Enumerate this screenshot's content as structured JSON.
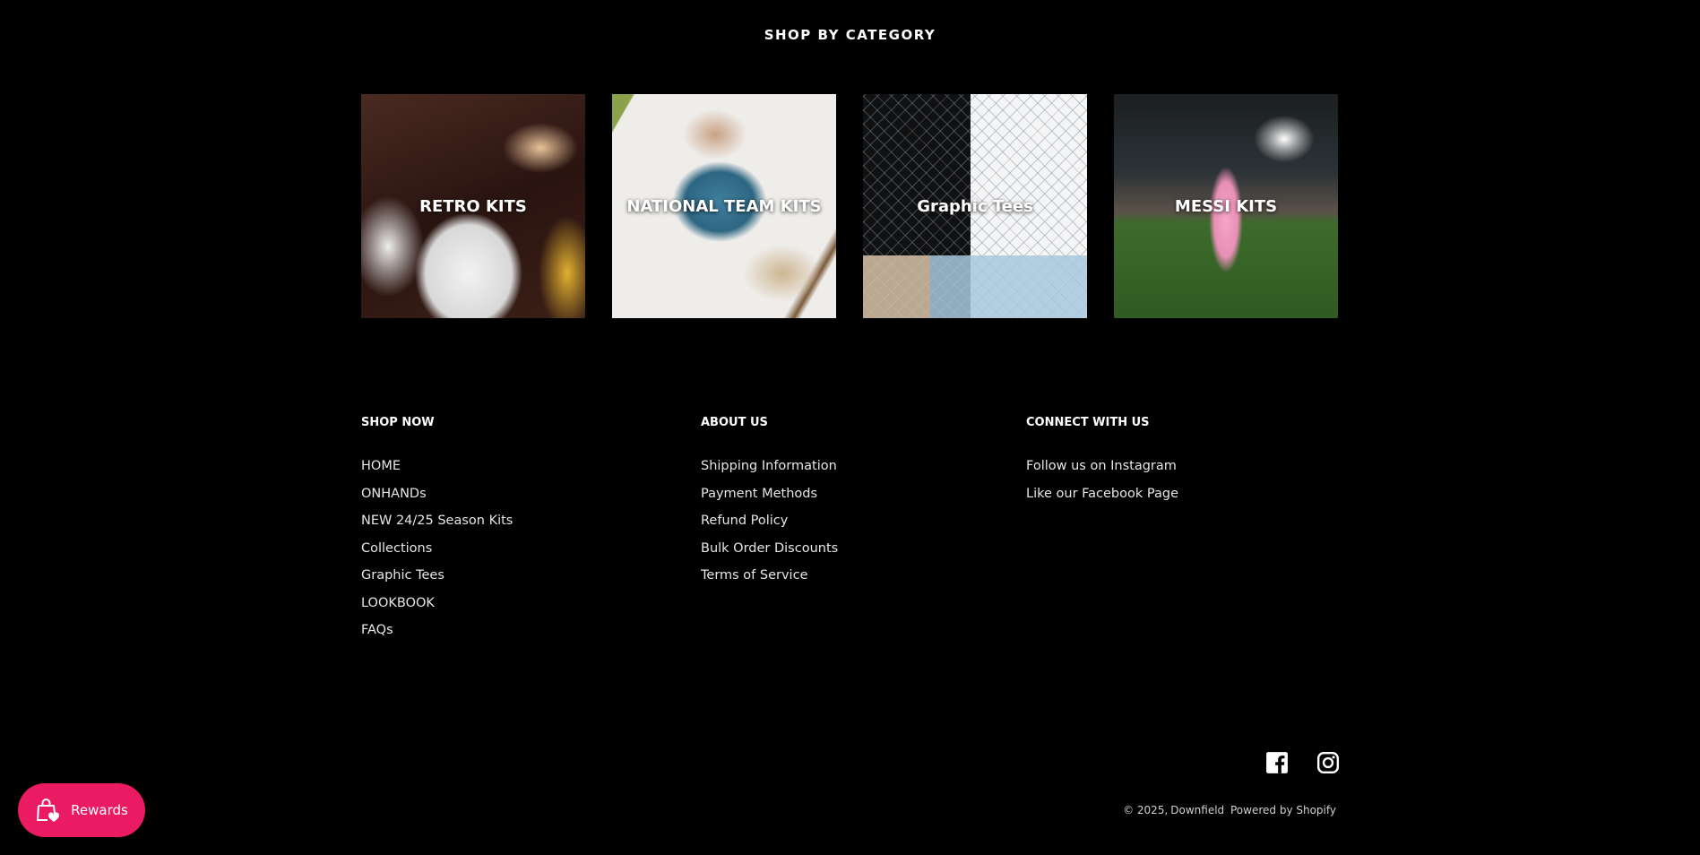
{
  "section_title": "SHOP BY CATEGORY",
  "categories": [
    {
      "label": "RETRO KITS"
    },
    {
      "label": "NATIONAL TEAM KITS"
    },
    {
      "label": "Graphic Tees"
    },
    {
      "label": "MESSI KITS"
    }
  ],
  "footer": {
    "shop_now": {
      "title": "SHOP NOW",
      "links": [
        "HOME",
        "ONHANDs",
        "NEW 24/25 Season Kits",
        "Collections",
        "Graphic Tees",
        "LOOKBOOK",
        "FAQs"
      ]
    },
    "about_us": {
      "title": "ABOUT US",
      "links": [
        "Shipping Information",
        "Payment Methods",
        "Refund Policy",
        "Bulk Order Discounts",
        "Terms of Service"
      ]
    },
    "connect": {
      "title": "CONNECT WITH US",
      "links": [
        "Follow us on Instagram",
        "Like our Facebook Page"
      ]
    }
  },
  "social_icons": [
    "facebook-icon",
    "instagram-icon"
  ],
  "copyright": {
    "year_text": "© 2025,",
    "brand": "Downfield",
    "powered": "Powered by Shopify"
  },
  "rewards": {
    "label": "Rewards",
    "color": "#ea1a63"
  }
}
